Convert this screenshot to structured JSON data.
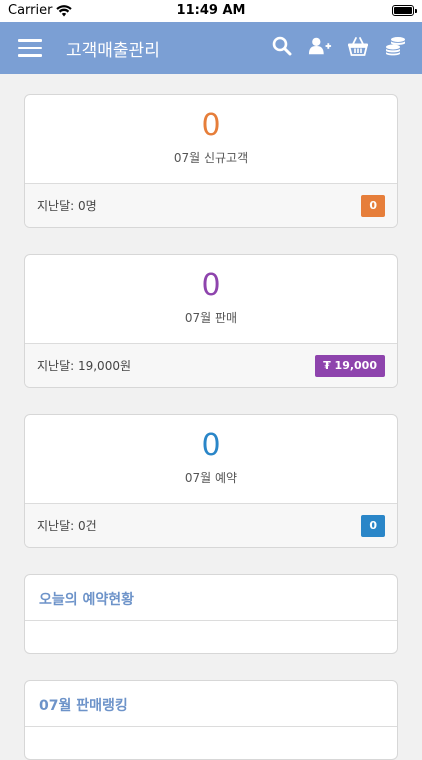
{
  "status": {
    "carrier": "Carrier",
    "time": "11:49 AM"
  },
  "header": {
    "title": "고객매출관리",
    "icons": [
      "menu-icon",
      "search-icon",
      "add-user-icon",
      "basket-icon",
      "coins-icon"
    ]
  },
  "colors": {
    "nav": "#7b9fd4",
    "orange": "#e67e3a",
    "purple": "#8e44ad",
    "blue": "#2a86c8",
    "section_title": "#6d93c9"
  },
  "cards": {
    "new_customers": {
      "value": "0",
      "label": "07월 신규고객",
      "footer": "지난달: 0명",
      "badge": "0"
    },
    "sales": {
      "value": "0",
      "label": "07월 판매",
      "footer": "지난달: 19,000원",
      "badge": "₮ 19,000"
    },
    "reservations": {
      "value": "0",
      "label": "07월 예약",
      "footer": "지난달: 0건",
      "badge": "0"
    }
  },
  "sections": {
    "today_reservations": {
      "title": "오늘의 예약현황"
    },
    "sales_ranking": {
      "title": "07월 판매랭킹"
    }
  }
}
